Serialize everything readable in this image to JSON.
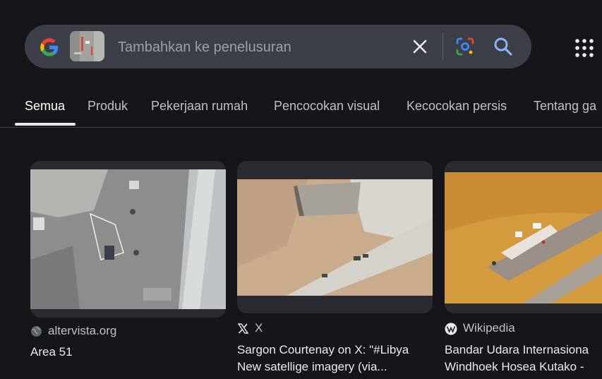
{
  "search": {
    "placeholder": "Tambahkan ke penelusuran",
    "value": ""
  },
  "tabs": [
    {
      "label": "Semua",
      "active": true
    },
    {
      "label": "Produk"
    },
    {
      "label": "Pekerjaan rumah"
    },
    {
      "label": "Pencocokan visual"
    },
    {
      "label": "Kecocokan persis"
    },
    {
      "label": "Tentang ga"
    }
  ],
  "results": [
    {
      "source": "altervista.org",
      "title_line1": "Area 51",
      "title_line2": "",
      "source_icon": "globe-icon"
    },
    {
      "source": "X",
      "title_line1": "Sargon Courtenay on X: \"#Libya",
      "title_line2": "New satellige imagery (via...",
      "source_icon": "x-logo-icon"
    },
    {
      "source": "Wikipedia",
      "title_line1": "Bandar Udara Internasiona",
      "title_line2": "Windhoek Hosea Kutako -",
      "source_icon": "wikipedia-icon"
    }
  ],
  "colors": {
    "background": "#16161a",
    "search_bar": "#3c3f48",
    "accent_blue": "#8ab4f8"
  }
}
